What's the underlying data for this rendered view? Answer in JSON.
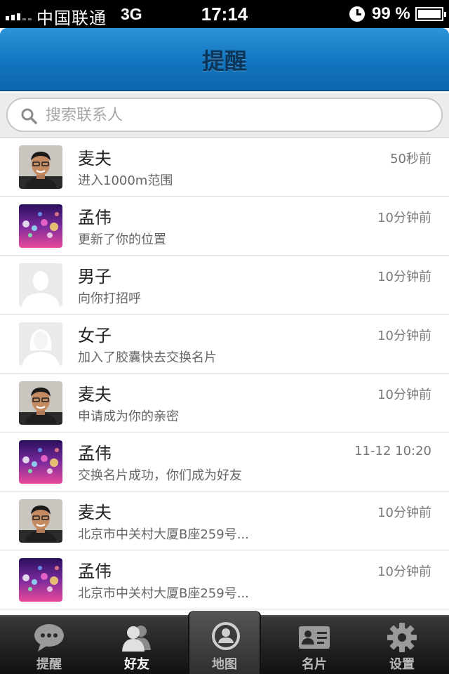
{
  "status_bar": {
    "carrier": "中国联通",
    "network": "3G",
    "time": "17:14",
    "battery": "99 %",
    "battery_level": 0.99
  },
  "nav": {
    "title": "提醒"
  },
  "search": {
    "placeholder": "搜索联系人",
    "value": ""
  },
  "list": {
    "items": [
      {
        "name": "麦夫",
        "message": "进入1000m范围",
        "time": "50秒前",
        "avatar": "man-photo"
      },
      {
        "name": "孟伟",
        "message": "更新了你的位置",
        "time": "10分钟前",
        "avatar": "bokeh-photo"
      },
      {
        "name": "男子",
        "message": "向你打招呼",
        "time": "10分钟前",
        "avatar": "male-placeholder"
      },
      {
        "name": "女子",
        "message": "加入了胶囊快去交换名片",
        "time": "10分钟前",
        "avatar": "female-placeholder"
      },
      {
        "name": "麦夫",
        "message": "申请成为你的亲密",
        "time": "10分钟前",
        "avatar": "man-photo"
      },
      {
        "name": "孟伟",
        "message": "交换名片成功，你们成为好友",
        "time": "11-12 10:20",
        "avatar": "bokeh-photo"
      },
      {
        "name": "麦夫",
        "message": "北京市中关村大厦B座259号...",
        "time": "10分钟前",
        "avatar": "man-photo"
      },
      {
        "name": "孟伟",
        "message": "北京市中关村大厦B座259号...",
        "time": "10分钟前",
        "avatar": "bokeh-photo"
      }
    ]
  },
  "tab_bar": {
    "tabs": [
      {
        "label": "提醒",
        "icon": "chat-bubble-icon"
      },
      {
        "label": "好友",
        "icon": "friends-icon"
      },
      {
        "label": "地图",
        "icon": "map-pin-icon"
      },
      {
        "label": "名片",
        "icon": "card-icon"
      },
      {
        "label": "设置",
        "icon": "gear-icon"
      }
    ],
    "active": "好友"
  }
}
